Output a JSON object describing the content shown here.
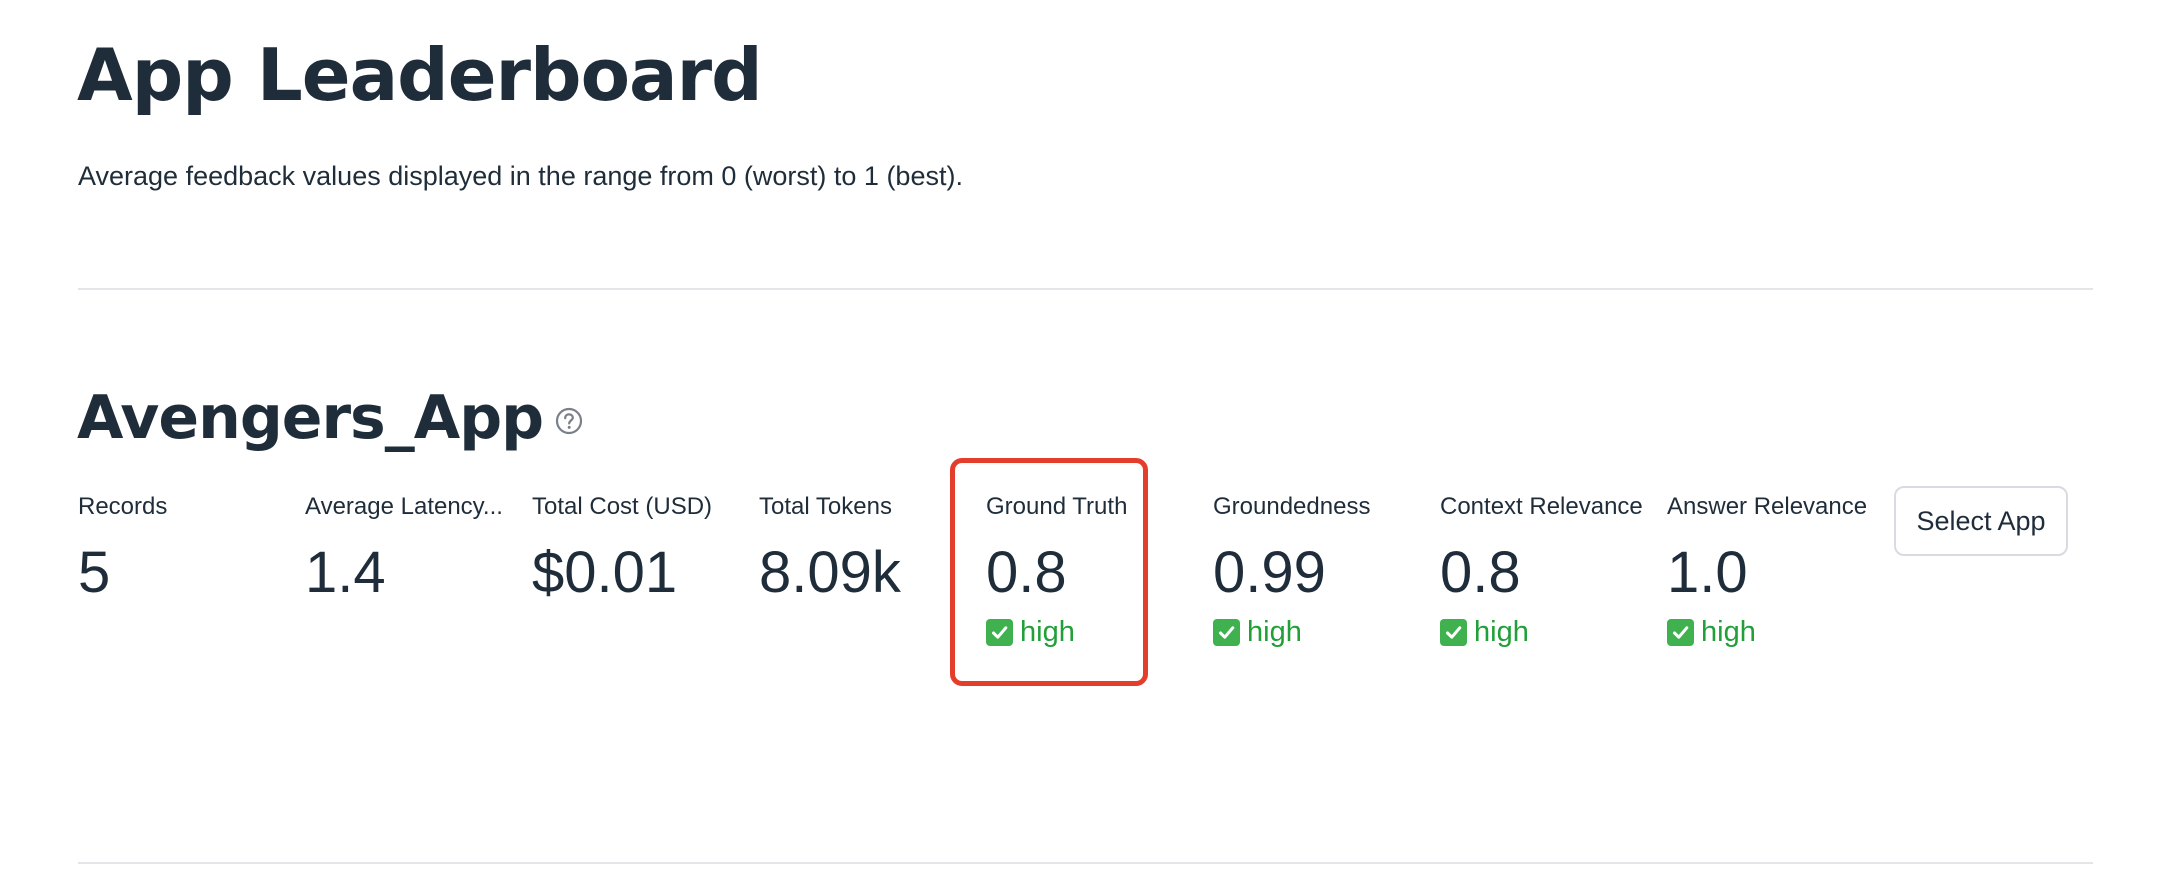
{
  "page": {
    "title": "App Leaderboard",
    "subtitle": "Average feedback values displayed in the range from 0 (worst) to 1 (best)."
  },
  "app": {
    "name": "Avengers_App",
    "help_icon": "question-circle-icon",
    "select_button_label": "Select App",
    "metrics": [
      {
        "label": "Records",
        "value": "5",
        "delta": ""
      },
      {
        "label": "Average Latency...",
        "value": "1.4",
        "delta": ""
      },
      {
        "label": "Total Cost (USD)",
        "value": "$0.01",
        "delta": ""
      },
      {
        "label": "Total Tokens",
        "value": "8.09k",
        "delta": ""
      },
      {
        "label": "Ground Truth",
        "value": "0.8",
        "delta": "high"
      },
      {
        "label": "Groundedness",
        "value": "0.99",
        "delta": "high"
      },
      {
        "label": "Context Relevance",
        "value": "0.8",
        "delta": "high"
      },
      {
        "label": "Answer Relevance",
        "value": "1.0",
        "delta": "high"
      }
    ]
  },
  "colors": {
    "text": "#1f2d3a",
    "delta_green": "#21a038",
    "check_green": "#3fb24f",
    "highlight_red": "#e53d2b",
    "divider": "#e3e5e8"
  }
}
